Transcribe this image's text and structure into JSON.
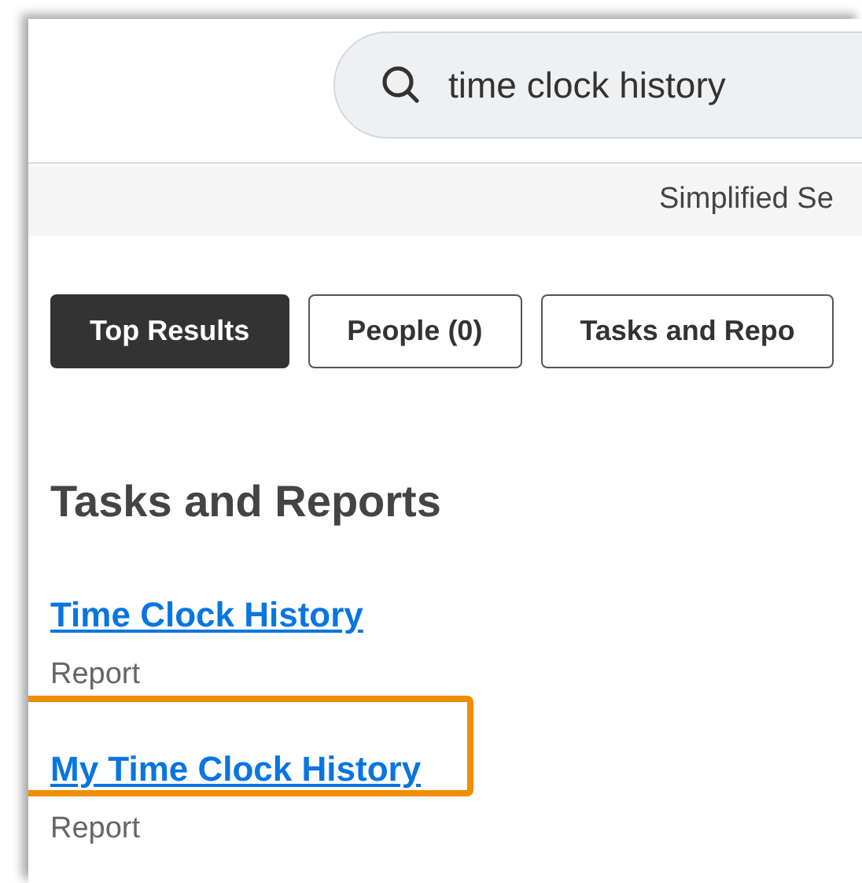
{
  "search": {
    "value": "time clock history"
  },
  "banner": {
    "text": "Simplified Se"
  },
  "tabs": [
    {
      "label": "Top Results",
      "selected": true
    },
    {
      "label": "People (0)",
      "selected": false
    },
    {
      "label": "Tasks and Repo",
      "selected": false
    }
  ],
  "section": {
    "title": "Tasks and Reports",
    "results": [
      {
        "title": "Time Clock History",
        "type": "Report",
        "highlighted": false
      },
      {
        "title": "My Time Clock History",
        "type": "Report",
        "highlighted": true
      }
    ]
  }
}
